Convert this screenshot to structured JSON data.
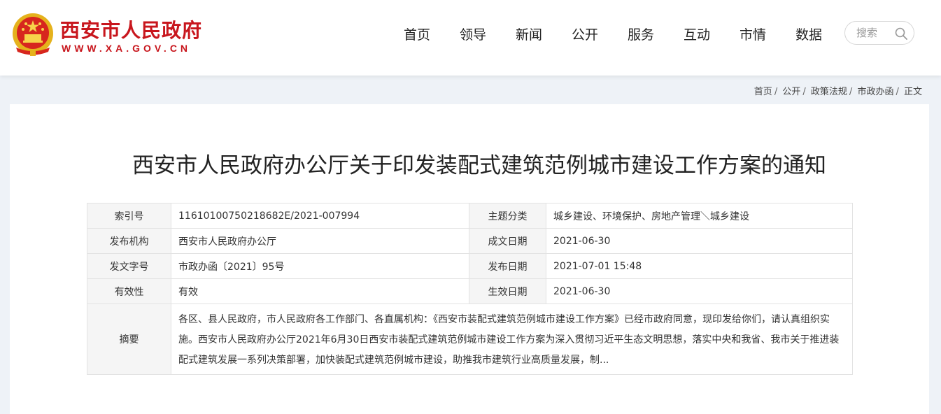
{
  "header": {
    "site_title": "西安市人民政府",
    "site_url": "WWW.XA.GOV.CN",
    "brand_color": "#c8161d",
    "nav": [
      "首页",
      "领导",
      "新闻",
      "公开",
      "服务",
      "互动",
      "市情",
      "数据"
    ],
    "search_placeholder": "搜索"
  },
  "breadcrumb": [
    "首页",
    "公开",
    "政策法规",
    "市政办函",
    "正文"
  ],
  "document": {
    "title": "西安市人民政府办公厅关于印发装配式建筑范例城市建设工作方案的通知",
    "meta": {
      "index_no_label": "索引号",
      "index_no": "11610100750218682E/2021-007994",
      "subject_label": "主题分类",
      "subject": "城乡建设、环境保护、房地产管理＼城乡建设",
      "issuer_label": "发布机构",
      "issuer": "西安市人民政府办公厅",
      "created_label": "成文日期",
      "created": "2021-06-30",
      "doc_no_label": "发文字号",
      "doc_no": "市政办函〔2021〕95号",
      "published_label": "发布日期",
      "published": "2021-07-01 15:48",
      "validity_label": "有效性",
      "validity": "有效",
      "effective_label": "生效日期",
      "effective": "2021-06-30",
      "abstract_label": "摘要",
      "abstract": "各区、县人民政府，市人民政府各工作部门、各直属机构：《西安市装配式建筑范例城市建设工作方案》已经市政府同意，现印发给你们，请认真组织实施。西安市人民政府办公厅2021年6月30日西安市装配式建筑范例城市建设工作方案为深入贯彻习近平生态文明思想，落实中央和我省、我市关于推进装配式建筑发展一系列决策部署，加快装配式建筑范例城市建设，助推我市建筑行业高质量发展，制..."
    }
  }
}
